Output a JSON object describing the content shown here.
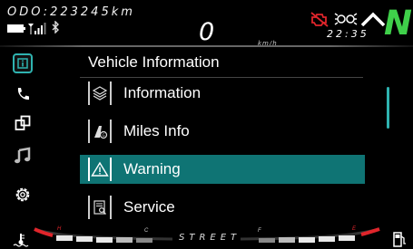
{
  "status": {
    "odometer": "ODO:223245km",
    "speed": "0",
    "speed_unit": "km/h",
    "clock": "22:35",
    "gear": "N",
    "bluetooth_glyph": "฿"
  },
  "sidebar": {
    "items": [
      {
        "name": "info-icon",
        "active": true
      },
      {
        "name": "phone-icon",
        "active": false
      },
      {
        "name": "connect-icon",
        "active": false
      },
      {
        "name": "music-icon",
        "active": false
      },
      {
        "name": "settings-icon",
        "active": false
      }
    ]
  },
  "menu": {
    "title": "Vehicle Information",
    "items": [
      {
        "label": "Information",
        "icon": "layers-icon",
        "selected": false
      },
      {
        "label": "Miles Info",
        "icon": "road-icon",
        "selected": false
      },
      {
        "label": "Warning",
        "icon": "warning-triangle-icon",
        "selected": true
      },
      {
        "label": "Service",
        "icon": "service-document-icon",
        "selected": false
      }
    ]
  },
  "gauges": {
    "temp_hot_label": "H",
    "temp_cold_label": "C",
    "fuel_full_label": "F",
    "fuel_empty_label": "E",
    "riding_mode": "STREET"
  },
  "colors": {
    "accent": "#2fb3b0",
    "selected_row": "#0f7474",
    "neutral_gear": "#3fd04a",
    "warning_red": "#e0252b"
  }
}
